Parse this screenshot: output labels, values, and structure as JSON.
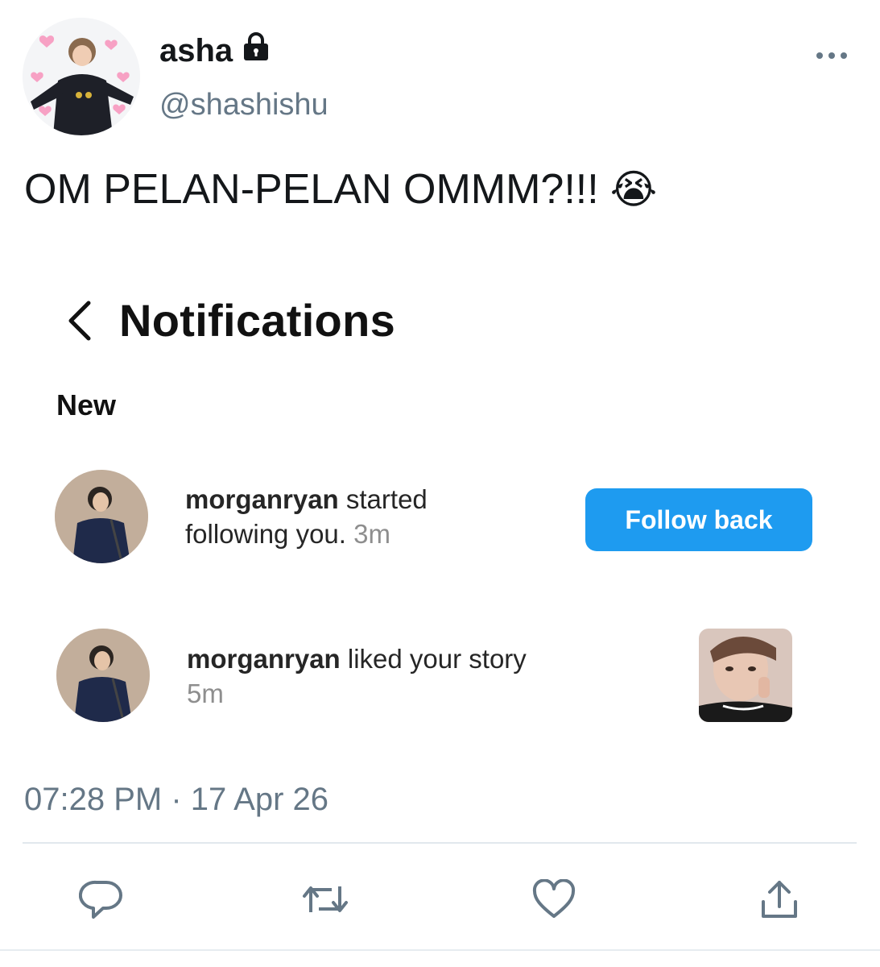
{
  "tweet": {
    "display_name": "asha",
    "handle": "@shashishu",
    "locked_icon": "lock-icon",
    "more_icon": "more-horizontal-icon",
    "text": "OM PELAN-PELAN OMMM?!!!",
    "emoji": "😭",
    "timestamp": "07:28 PM · 17 Apr 26"
  },
  "screenshot": {
    "back_icon": "chevron-left-icon",
    "title": "Notifications",
    "section": "New",
    "notifications": [
      {
        "user": "morganryan",
        "action_line1": " started",
        "action_line2": "following you.",
        "time": "3m",
        "button_label": "Follow back"
      },
      {
        "user": "morganryan",
        "action_line1": " liked your story",
        "time": "5m"
      }
    ]
  },
  "actions": [
    {
      "icon": "reply-icon"
    },
    {
      "icon": "retweet-icon"
    },
    {
      "icon": "like-icon"
    },
    {
      "icon": "share-icon"
    }
  ],
  "colors": {
    "accent": "#1e9bf0",
    "secondary_text": "#657786",
    "divider": "#e1e8ed"
  }
}
